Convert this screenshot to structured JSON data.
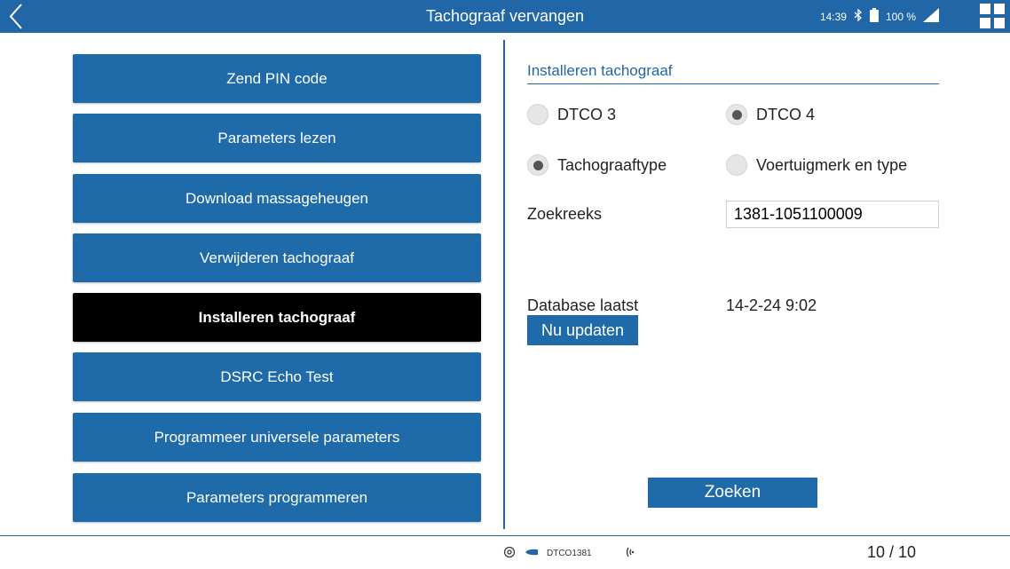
{
  "header": {
    "title": "Tachograaf vervangen",
    "time": "14:39",
    "battery": "100 %"
  },
  "menu": {
    "items": [
      {
        "label": "Zend PIN code",
        "active": false
      },
      {
        "label": "Parameters lezen",
        "active": false
      },
      {
        "label": "Download massageheugen",
        "active": false
      },
      {
        "label": "Verwijderen tachograaf",
        "active": false
      },
      {
        "label": "Installeren tachograaf",
        "active": true
      },
      {
        "label": "DSRC Echo Test",
        "active": false
      },
      {
        "label": "Programmeer universele parameters",
        "active": false
      },
      {
        "label": "Parameters programmeren",
        "active": false
      }
    ]
  },
  "panel": {
    "title": "Installeren tachograaf",
    "dtco3": "DTCO 3",
    "dtco4": "DTCO 4",
    "tachotype": "Tachograaftype",
    "vehicle": "Voertuigmerk en type",
    "zoekreeks_label": "Zoekreeks",
    "zoekreeks_value": "1381-1051100009",
    "database_label": "Database laatst",
    "database_value": "14-2-24 9:02",
    "update_button": "Nu updaten",
    "search_button": "Zoeken"
  },
  "footer": {
    "device": "DTCO1381",
    "page": "10 / 10"
  },
  "colors": {
    "primary": "#1f6aa8",
    "active": "#000000",
    "header": "#2166a6"
  }
}
